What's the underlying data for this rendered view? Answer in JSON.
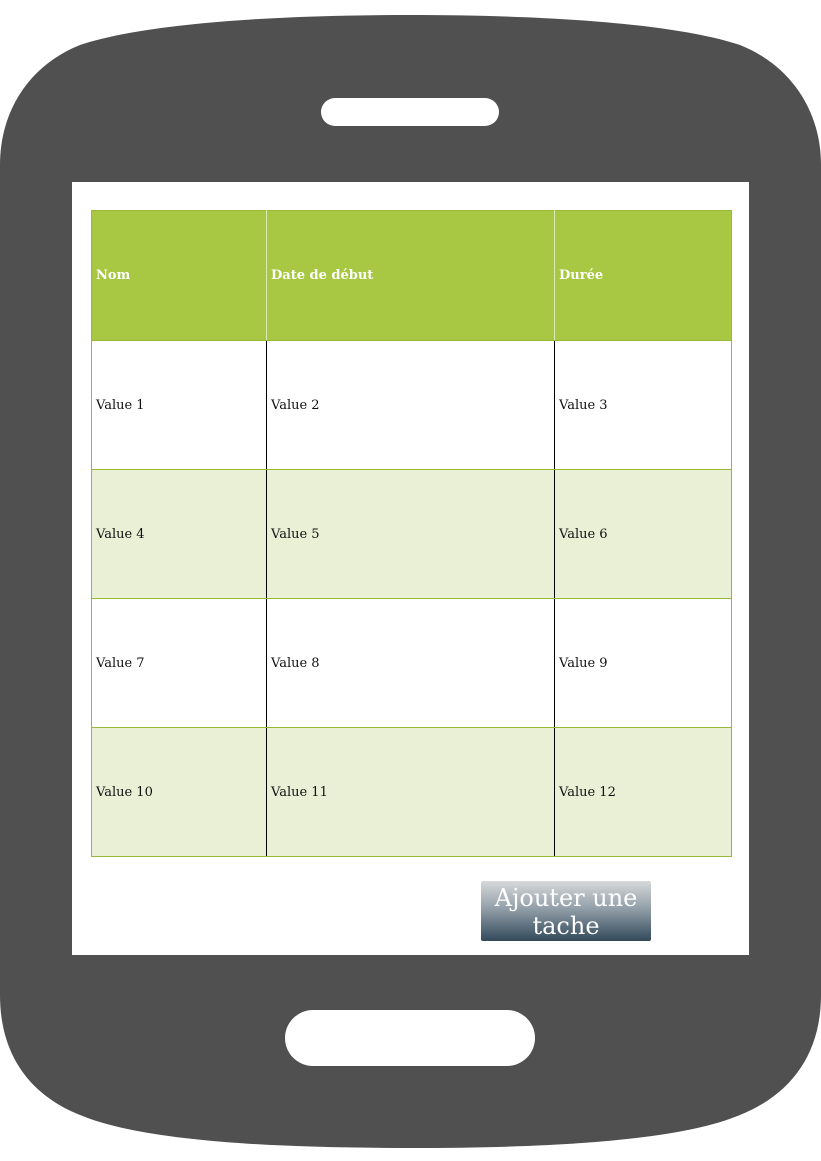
{
  "table": {
    "headers": [
      "Nom",
      "Date de début",
      "Durée"
    ],
    "rows": [
      [
        "Value 1",
        "Value 2",
        "Value 3"
      ],
      [
        "Value 4",
        "Value 5",
        "Value 6"
      ],
      [
        "Value 7",
        "Value 8",
        "Value 9"
      ],
      [
        "Value 10",
        "Value 11",
        "Value 12"
      ]
    ]
  },
  "actions": {
    "add_task_label": "Ajouter une tache"
  },
  "colors": {
    "phone_body": "#505050",
    "header_bg": "#a8c843",
    "row_alt_bg": "#e9f0d6",
    "button_top": "#d6d9da",
    "button_bottom": "#32495a"
  }
}
